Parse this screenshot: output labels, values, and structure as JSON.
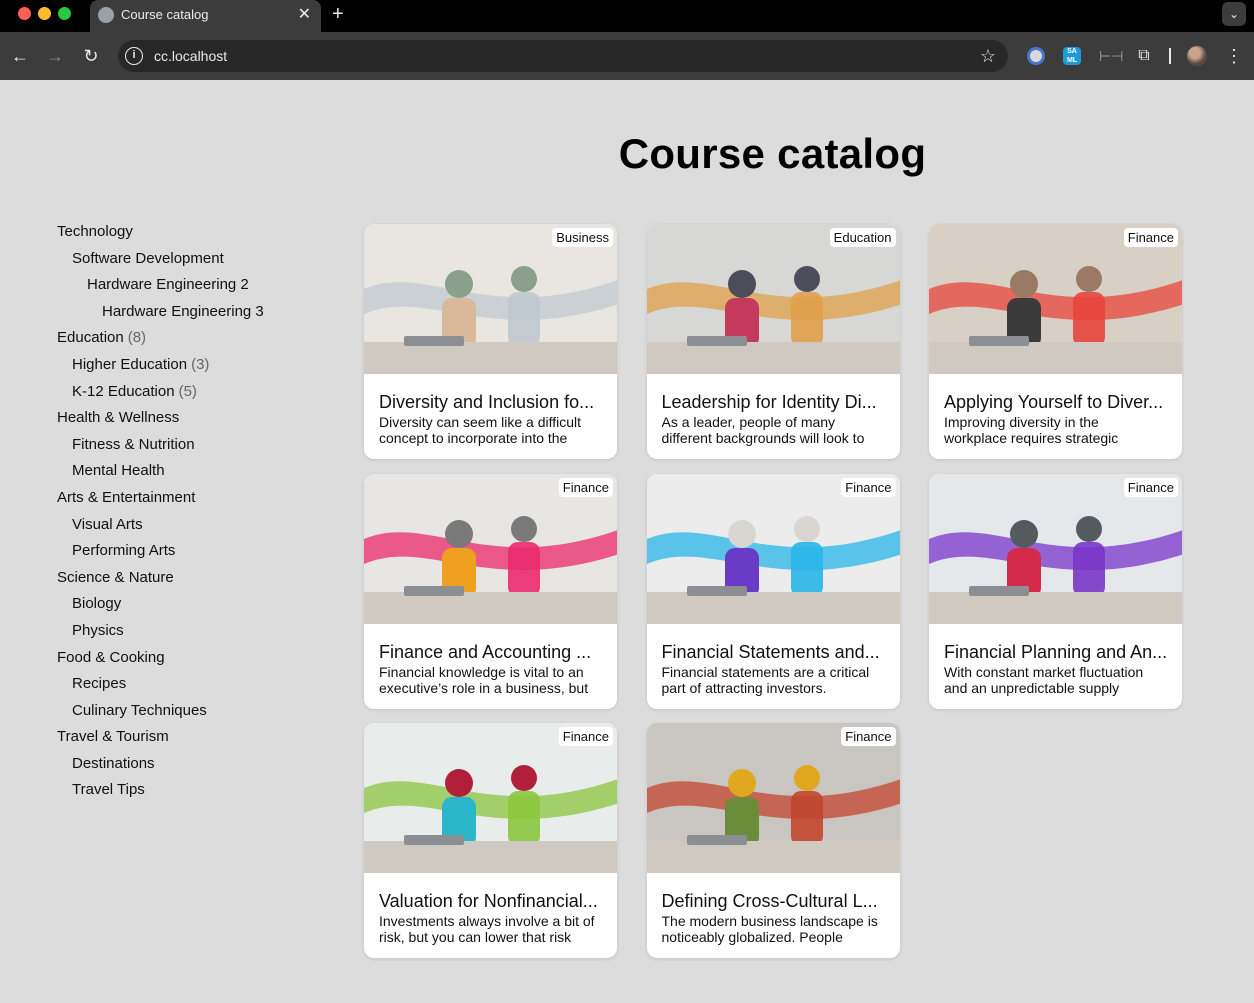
{
  "browser": {
    "tab_title": "Course catalog",
    "tab_close": "✕",
    "new_tab": "+",
    "url": "cc.localhost"
  },
  "page": {
    "title": "Course catalog"
  },
  "sidebar": {
    "categories": [
      {
        "label": "Technology",
        "count": "",
        "level": 0
      },
      {
        "label": "Software Development",
        "count": "",
        "level": 1
      },
      {
        "label": "Hardware Engineering 2",
        "count": "",
        "level": 2
      },
      {
        "label": "Hardware Engineering 3",
        "count": "",
        "level": 3
      },
      {
        "label": "Education",
        "count": "(8)",
        "level": 0
      },
      {
        "label": "Higher Education",
        "count": "(3)",
        "level": 1
      },
      {
        "label": "K-12 Education",
        "count": "(5)",
        "level": 1
      },
      {
        "label": "Health & Wellness",
        "count": "",
        "level": 0
      },
      {
        "label": "Fitness & Nutrition",
        "count": "",
        "level": 1
      },
      {
        "label": "Mental Health",
        "count": "",
        "level": 1
      },
      {
        "label": "Arts & Entertainment",
        "count": "",
        "level": 0
      },
      {
        "label": "Visual Arts",
        "count": "",
        "level": 1
      },
      {
        "label": "Performing Arts",
        "count": "",
        "level": 1
      },
      {
        "label": "Science & Nature",
        "count": "",
        "level": 0
      },
      {
        "label": "Biology",
        "count": "",
        "level": 1
      },
      {
        "label": "Physics",
        "count": "",
        "level": 1
      },
      {
        "label": "Food & Cooking",
        "count": "",
        "level": 0
      },
      {
        "label": "Recipes",
        "count": "",
        "level": 1
      },
      {
        "label": "Culinary Techniques",
        "count": "",
        "level": 1
      },
      {
        "label": "Travel & Tourism",
        "count": "",
        "level": 0
      },
      {
        "label": "Destinations",
        "count": "",
        "level": 1
      },
      {
        "label": "Travel Tips",
        "count": "",
        "level": 1
      }
    ]
  },
  "courses": [
    {
      "category": "Business",
      "title": "Diversity and Inclusion fo...",
      "description": "Diversity can seem like a difficult concept to incorporate into the",
      "palette": [
        "#e9e6e1",
        "#bfc8cf",
        "#d9b99a",
        "#8aa08c"
      ]
    },
    {
      "category": "Education",
      "title": "Leadership for Identity Di...",
      "description": "As a leader, people of many different backgrounds will look to",
      "palette": [
        "#d7d7d5",
        "#e0a04a",
        "#c43a5c",
        "#4b4e5a"
      ]
    },
    {
      "category": "Finance",
      "title": "Applying Yourself to Diver...",
      "description": "Improving diversity in the workplace requires strategic",
      "palette": [
        "#d8cfc5",
        "#e8453a",
        "#3a3a3a",
        "#9a7a64"
      ]
    },
    {
      "category": "Finance",
      "title": "Finance and Accounting ...",
      "description": "Financial knowledge is vital to an executive’s role in a business, but",
      "palette": [
        "#e8e6e3",
        "#ec2a6e",
        "#f0a020",
        "#7a7a7a"
      ]
    },
    {
      "category": "Finance",
      "title": "Financial Statements and...",
      "description": "Financial statements are a critical part of attracting investors.",
      "palette": [
        "#ececec",
        "#29b6e8",
        "#6a3bc7",
        "#d9d6d2"
      ]
    },
    {
      "category": "Finance",
      "title": "Financial Planning and An...",
      "description": "With constant market fluctuation and an unpredictable supply",
      "palette": [
        "#e4e8ea",
        "#7a35c9",
        "#d42a4a",
        "#555a5f"
      ]
    },
    {
      "category": "Finance",
      "title": "Valuation for Nonfinancial...",
      "description": "Investments always involve a bit of risk, but you can lower that risk",
      "palette": [
        "#e8ecea",
        "#8cc63f",
        "#2bb6c9",
        "#b0203a"
      ]
    },
    {
      "category": "Finance",
      "title": "Defining Cross-Cultural L...",
      "description": "The modern business landscape is noticeably globalized. People",
      "palette": [
        "#c9c6c2",
        "#c2462e",
        "#6b8c3a",
        "#e0a81e"
      ]
    }
  ]
}
